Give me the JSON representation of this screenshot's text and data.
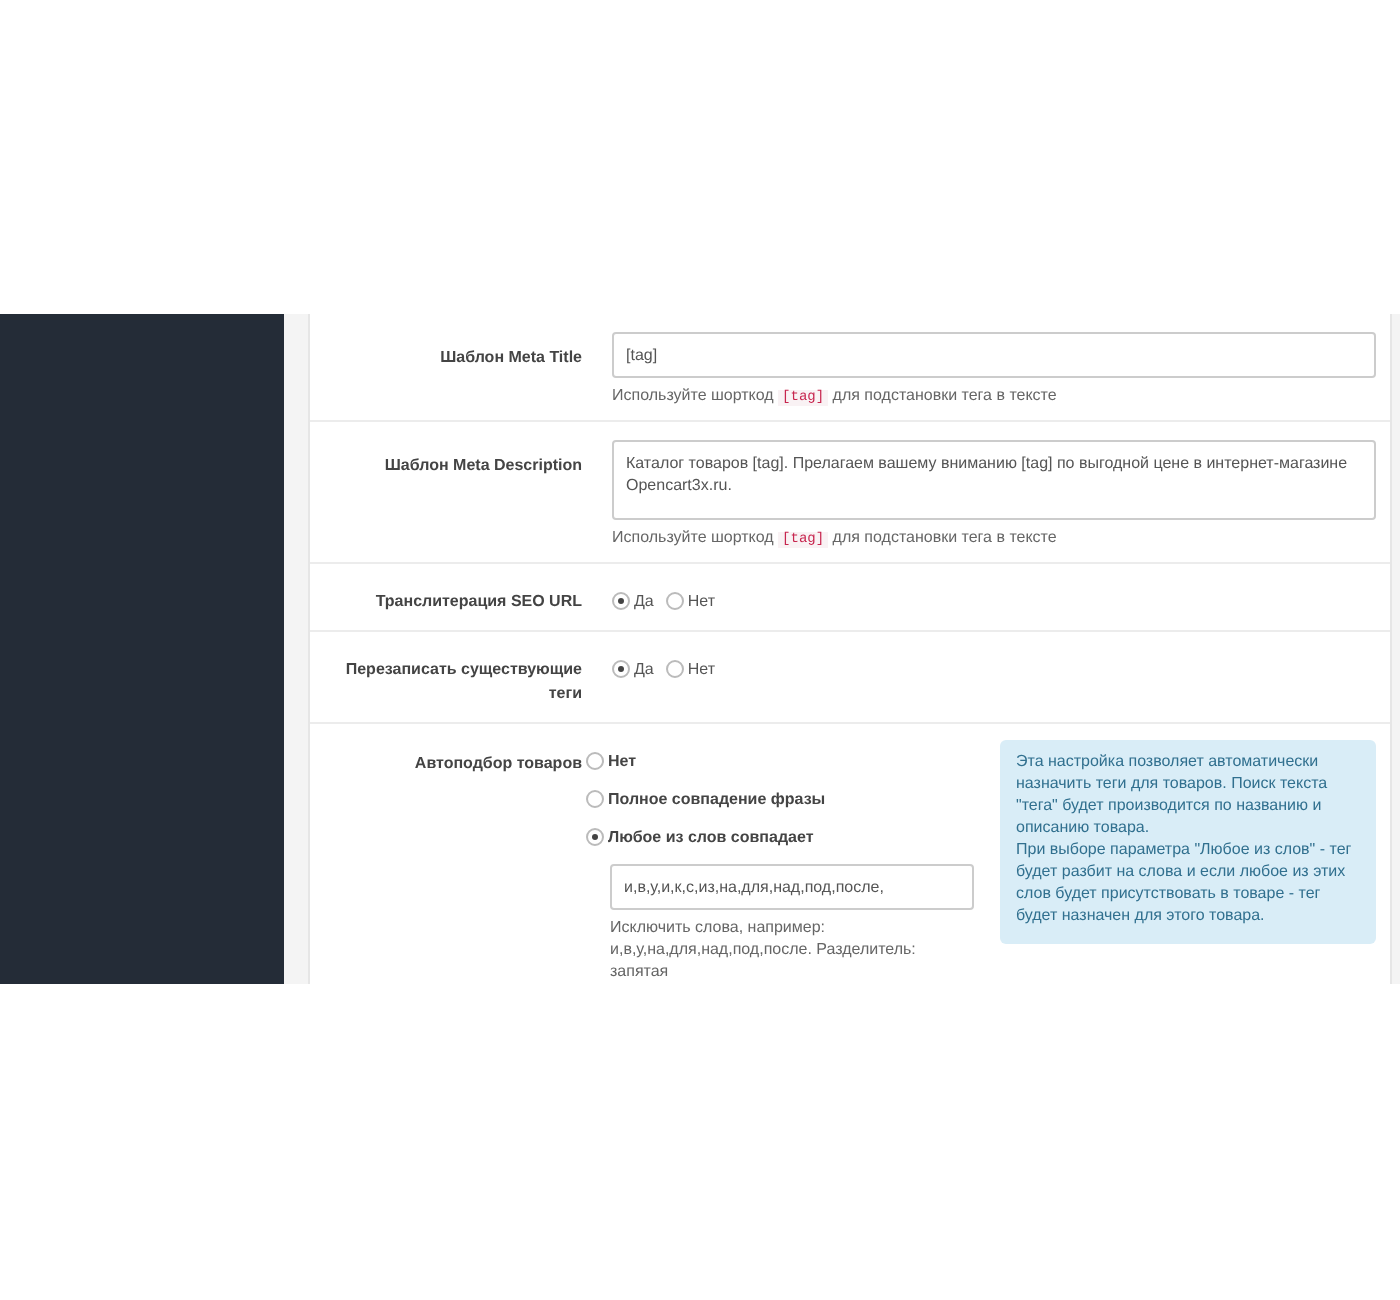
{
  "settings": [
    {
      "kind": "text",
      "label": "Шаблон Meta Title",
      "value": "[tag]",
      "hint": {
        "before": "Используйте шорткод",
        "code": "[tag]",
        "after": "для подстановки тега в тексте"
      }
    },
    {
      "kind": "textarea",
      "label": "Шаблон Meta Description",
      "value": "Каталог товаров [tag]. Прелагаем вашему вниманию [tag] по выгодной цене в интернет-магазине Opencart3x.ru.",
      "hint": {
        "before": "Используйте шорткод",
        "code": "[tag]",
        "after": "для подстановки тега в тексте"
      }
    },
    {
      "kind": "radio_inline",
      "label": "Транслитерация SEO URL",
      "options": [
        {
          "label": "Да",
          "selected": true
        },
        {
          "label": "Нет",
          "selected": false
        }
      ]
    },
    {
      "kind": "radio_inline",
      "label": "Перезаписать существующие теги",
      "options": [
        {
          "label": "Да",
          "selected": true
        },
        {
          "label": "Нет",
          "selected": false
        }
      ]
    },
    {
      "kind": "radio_stack",
      "label": "Автоподбор товаров",
      "options": [
        {
          "label": "Нет",
          "selected": false
        },
        {
          "label": "Полное совпадение фразы",
          "selected": false
        },
        {
          "label": "Любое из слов совпадает",
          "selected": true
        }
      ],
      "exclude_value": "и,в,у,и,к,с,из,на,для,над,под,после,",
      "exclude_hint": "Исключить слова, например: и,в,у,на,для,над,под,после. Разделитель: запятая",
      "info": [
        "Эта настройка позволяет автоматически назначить теги для товаров. Поиск текста \"тега\" будет производится по названию и описанию товара.",
        "При выборе параметра \"Любое из слов\" - тег будет разбит на слова и если любое из этих слов будет присутствовать в товаре - тег будет назначен для этого товара."
      ]
    }
  ]
}
